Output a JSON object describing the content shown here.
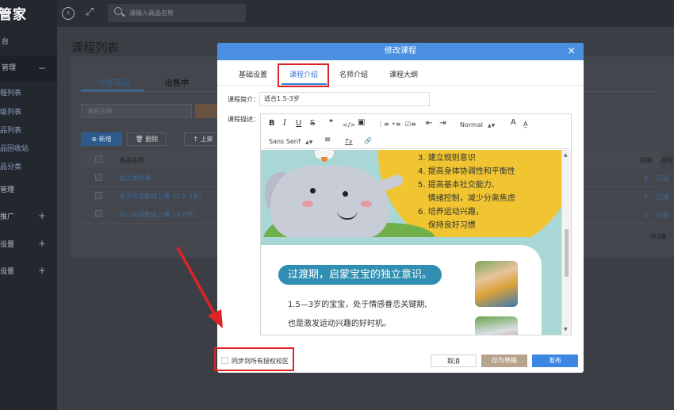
{
  "sidebar": {
    "brand": "管家",
    "items": [
      {
        "label": "台",
        "type": "item"
      },
      {
        "label": "管理",
        "type": "group",
        "toggle": "−"
      },
      {
        "label": "程列表",
        "type": "sub"
      },
      {
        "label": "级列表",
        "type": "sub"
      },
      {
        "label": "品列表",
        "type": "sub"
      },
      {
        "label": "品回收站",
        "type": "sub"
      },
      {
        "label": "品分类",
        "type": "sub"
      },
      {
        "label": "管理",
        "type": "item"
      },
      {
        "label": "推广",
        "type": "item",
        "toggle": "+"
      },
      {
        "label": "设置",
        "type": "item",
        "toggle": "+"
      },
      {
        "label": "设置",
        "type": "item",
        "toggle": "+"
      }
    ]
  },
  "topbar": {
    "search_placeholder": "请输入商品名称"
  },
  "page": {
    "title": "课程列表",
    "tabs": [
      "全部商品",
      "出售中"
    ],
    "filter_placeholder": "课程名称",
    "actions": {
      "add": "⊕ 新增",
      "delete": "🗑 删除",
      "up": "↑ 上架"
    },
    "table": {
      "header_name": "商品名称",
      "header_sales": "销量",
      "header_auth": "授权",
      "rows": [
        {
          "name": "线上体验课",
          "sales": "0",
          "auth": "已授"
        },
        {
          "name": "亲子体适能线上课（1.5-3岁）",
          "sales": "0",
          "auth": "已授"
        },
        {
          "name": "幼儿体适能线上课（3-6岁）",
          "sales": "0",
          "auth": "已授"
        }
      ],
      "total": "共3条"
    }
  },
  "modal": {
    "title": "修改课程",
    "close": "×",
    "tabs": [
      "基础设置",
      "课程介绍",
      "名师介绍",
      "课程大纲"
    ],
    "active_tab": "课程介绍",
    "brief_label": "课程简介：",
    "brief_value": "适合1.5-3岁",
    "desc_label": "课程描述：",
    "toolbar": {
      "bold": "B",
      "italic": "I",
      "underline": "U",
      "strike": "S",
      "quote": "❞",
      "code": "</>",
      "image": "▣",
      "ol": "⋮≡",
      "ul": "•≡",
      "check": "☑≡",
      "outdent": "⇤",
      "indent": "⇥",
      "heading": "Normal",
      "color": "A",
      "bg": "A̲",
      "font": "Sans Serif",
      "align": "≡",
      "clear": "Tx",
      "link": "🔗"
    },
    "content": {
      "illustration_list": [
        "3. 建立规则意识",
        "4. 提高身体协调性和平衡性",
        "5. 提高基本社交能力、",
        "    情绪控制，减少分离焦虑",
        "6. 培养运动兴趣，",
        "    保持良好习惯"
      ],
      "pill": "过渡期，启蒙宝宝的独立意识。",
      "para1": "1.5—3岁的宝宝，处于情感眷恋关键期,",
      "para2": "也是激发运动兴趣的好时机。"
    },
    "sync_label": "同步到所有授权校区",
    "buttons": {
      "cancel": "取消",
      "draft": "存为草稿",
      "publish": "发布"
    }
  },
  "colors": {
    "accent": "#4a8fe0",
    "highlight": "#e02424",
    "draft": "#b7a48e"
  }
}
